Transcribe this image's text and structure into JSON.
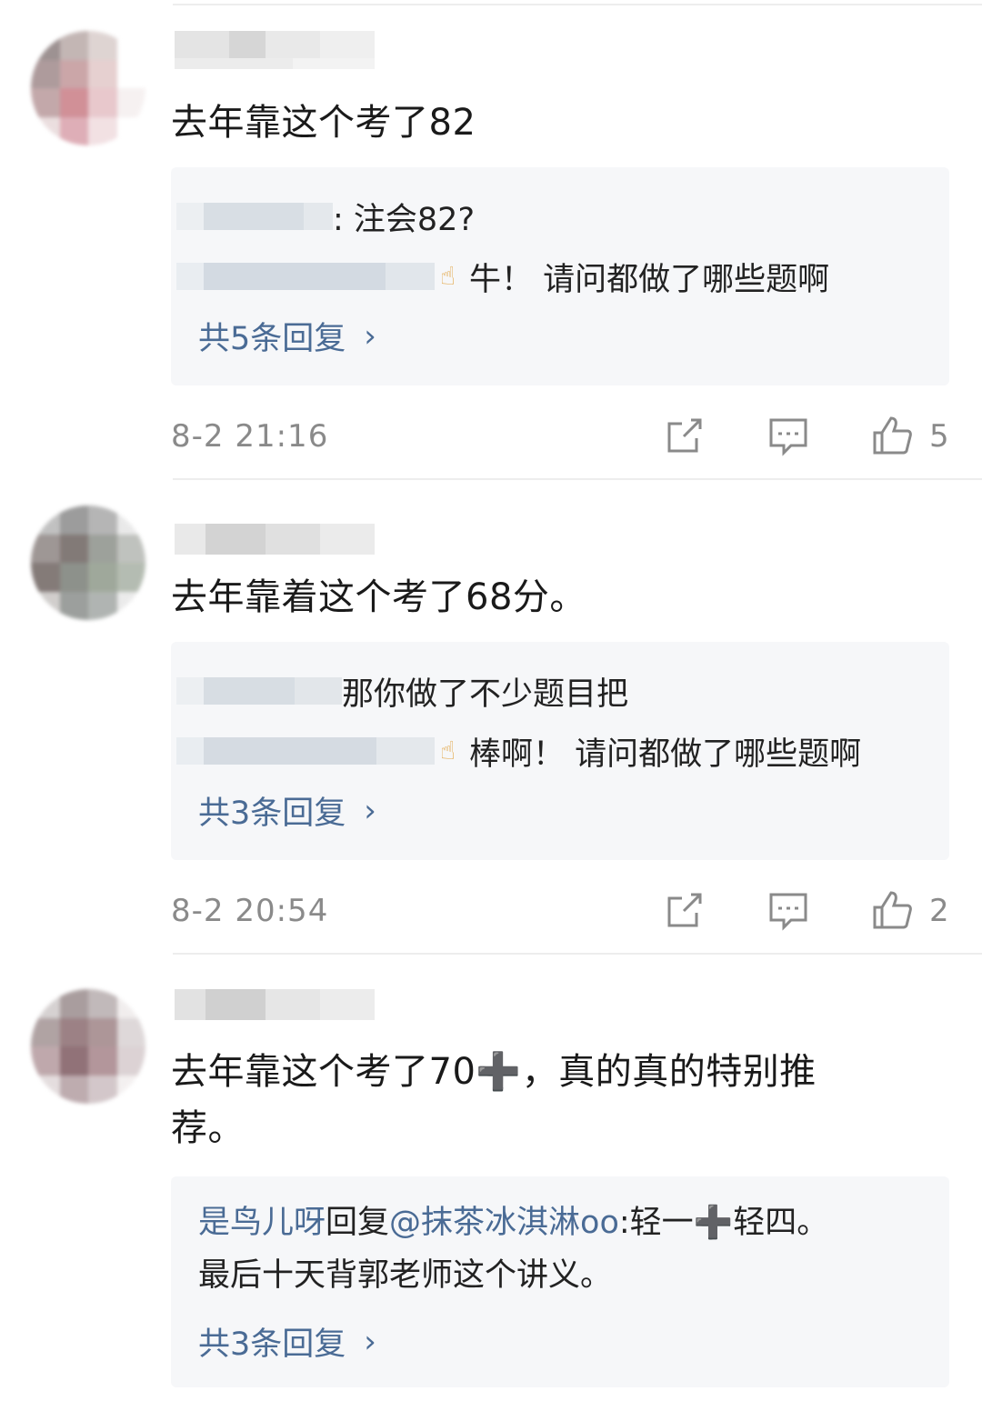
{
  "comments": [
    {
      "text": "去年靠这个考了82",
      "replies": [
        {
          "text": ": 注会82?"
        },
        {
          "text": "牛！ 请问都做了哪些题啊"
        }
      ],
      "more_label": "共5条回复",
      "timestamp": "8-2 21:16",
      "likes": "5"
    },
    {
      "text": "去年靠着这个考了68分。",
      "replies": [
        {
          "text": "那你做了不少题目把"
        },
        {
          "text": "棒啊！ 请问都做了哪些题啊"
        }
      ],
      "more_label": "共3条回复",
      "timestamp": "8-2 20:54",
      "likes": "2"
    },
    {
      "text_line1": "去年靠这个考了70➕，真的真的特别推",
      "text_line2": "荐。",
      "reply": {
        "author": "是鸟儿呀",
        "verb": "回复",
        "mention": "@抹茶冰淇淋oo",
        "text_line1": ":轻一➕轻四。",
        "text_line2": "最后十天背郭老师这个讲义。"
      },
      "more_label": "共3条回复"
    }
  ],
  "icons": {
    "share": "share-icon",
    "comment": "comment-icon",
    "like": "thumbs-up-icon",
    "chevron": "chevron-right-icon",
    "thumb_emoji": "thumbs-up-emoji-icon"
  },
  "colors": {
    "link": "#4a6b95",
    "meta": "#8a8a8a",
    "reply_bg": "#f6f7f9"
  }
}
